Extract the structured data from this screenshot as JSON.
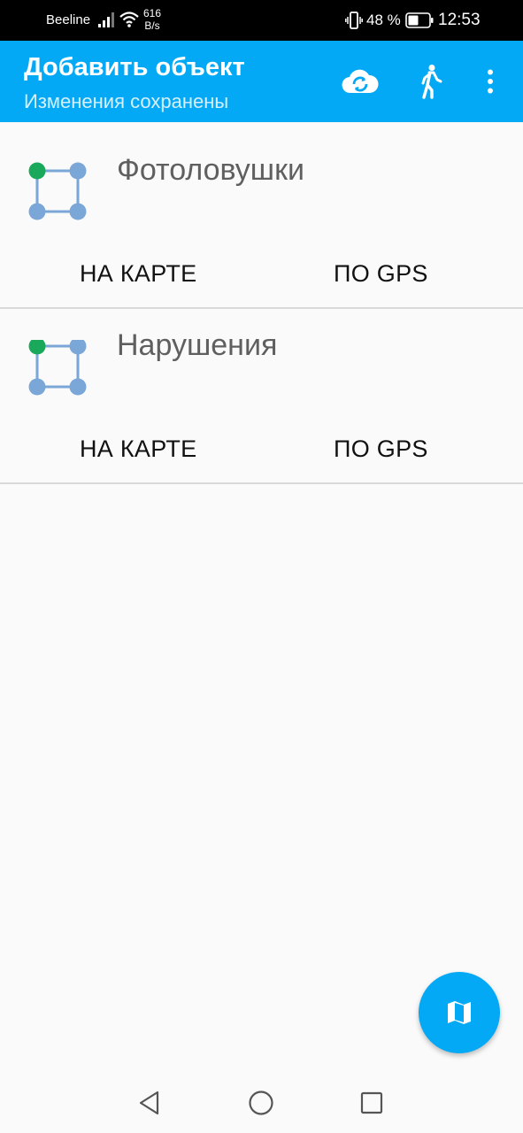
{
  "status_bar": {
    "carrier": "Beeline",
    "speed_value": "616",
    "speed_unit": "B/s",
    "battery": "48 %",
    "time": "12:53",
    "icons": [
      "signal-icon",
      "wifi-icon",
      "vibrate-icon",
      "battery-icon"
    ]
  },
  "app_bar": {
    "title": "Добавить объект",
    "subtitle": "Изменения сохранены",
    "actions": [
      "cloud-sync-icon",
      "walk-icon",
      "more-vert-icon"
    ],
    "color": "#03a9f4"
  },
  "layers": [
    {
      "name": "Фотоловушки",
      "icon": "polygon-layer-icon",
      "actions": {
        "map": "НА КАРТЕ",
        "gps": "ПО GPS"
      }
    },
    {
      "name": "Нарушения",
      "icon": "polygon-layer-icon",
      "actions": {
        "map": "НА КАРТЕ",
        "gps": "ПО GPS"
      }
    }
  ],
  "fab": {
    "icon": "map-icon"
  },
  "nav_bar": {
    "icons": [
      "back-icon",
      "home-icon",
      "recent-apps-icon"
    ]
  },
  "colors": {
    "accent": "#03a9f4",
    "vertex_active": "#1aa85a",
    "vertex": "#7aa7d8"
  }
}
